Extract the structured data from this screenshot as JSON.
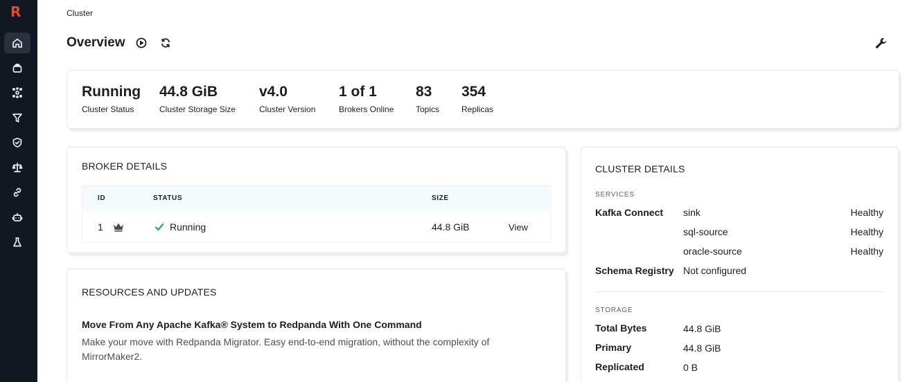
{
  "breadcrumb": "Cluster",
  "page_title": "Overview",
  "stats": [
    {
      "value": "Running",
      "label": "Cluster Status"
    },
    {
      "value": "44.8 GiB",
      "label": "Cluster Storage Size"
    },
    {
      "value": "v4.0",
      "label": "Cluster Version"
    },
    {
      "value": "1 of 1",
      "label": "Brokers Online"
    },
    {
      "value": "83",
      "label": "Topics"
    },
    {
      "value": "354",
      "label": "Replicas"
    }
  ],
  "broker_details": {
    "title": "BROKER DETAILS",
    "columns": [
      "ID",
      "STATUS",
      "SIZE"
    ],
    "rows": [
      {
        "id": "1",
        "status": "Running",
        "size": "44.8 GiB",
        "action": "View"
      }
    ]
  },
  "resources": {
    "title": "RESOURCES AND UPDATES",
    "heading": "Move From Any Apache Kafka® System to Redpanda With One Command",
    "body": "Make your move with Redpanda Migrator. Easy end-to-end migration, without the complexity of MirrorMaker2."
  },
  "cluster_details": {
    "title": "CLUSTER DETAILS",
    "services_label": "SERVICES",
    "kafka_connect_label": "Kafka Connect",
    "connectors": [
      {
        "name": "sink",
        "status": "Healthy"
      },
      {
        "name": "sql-source",
        "status": "Healthy"
      },
      {
        "name": "oracle-source",
        "status": "Healthy"
      }
    ],
    "schema_registry_label": "Schema Registry",
    "schema_registry_value": "Not configured",
    "storage_label": "STORAGE",
    "storage": [
      {
        "label": "Total Bytes",
        "value": "44.8 GiB"
      },
      {
        "label": "Primary",
        "value": "44.8 GiB"
      },
      {
        "label": "Replicated",
        "value": "0 B"
      }
    ]
  },
  "icons": {
    "logo": "redpanda-logo",
    "nav": [
      "home-icon",
      "topics-icon",
      "connect-icon",
      "filter-icon",
      "security-icon",
      "quotas-icon",
      "link-icon",
      "agent-icon",
      "lab-icon"
    ]
  },
  "colors": {
    "sidebar": "#121821",
    "logo": "#e2482c",
    "healthy": "#2fa84f"
  }
}
